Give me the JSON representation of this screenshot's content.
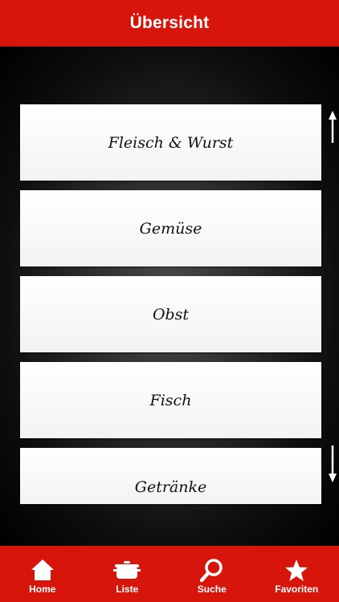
{
  "header": {
    "title": "Übersicht"
  },
  "categories": [
    {
      "label": "Fleisch & Wurst"
    },
    {
      "label": "Gemüse"
    },
    {
      "label": "Obst"
    },
    {
      "label": "Fisch"
    },
    {
      "label": "Getränke"
    }
  ],
  "scroll": {
    "up_icon": "arrow-up-icon",
    "down_icon": "arrow-down-icon"
  },
  "tabs": [
    {
      "label": "Home",
      "icon": "home-icon"
    },
    {
      "label": "Liste",
      "icon": "pot-icon"
    },
    {
      "label": "Suche",
      "icon": "search-icon"
    },
    {
      "label": "Favoriten",
      "icon": "star-icon"
    }
  ],
  "colors": {
    "accent": "#d7150b",
    "background": "#000000",
    "item_bg": "#ffffff"
  }
}
